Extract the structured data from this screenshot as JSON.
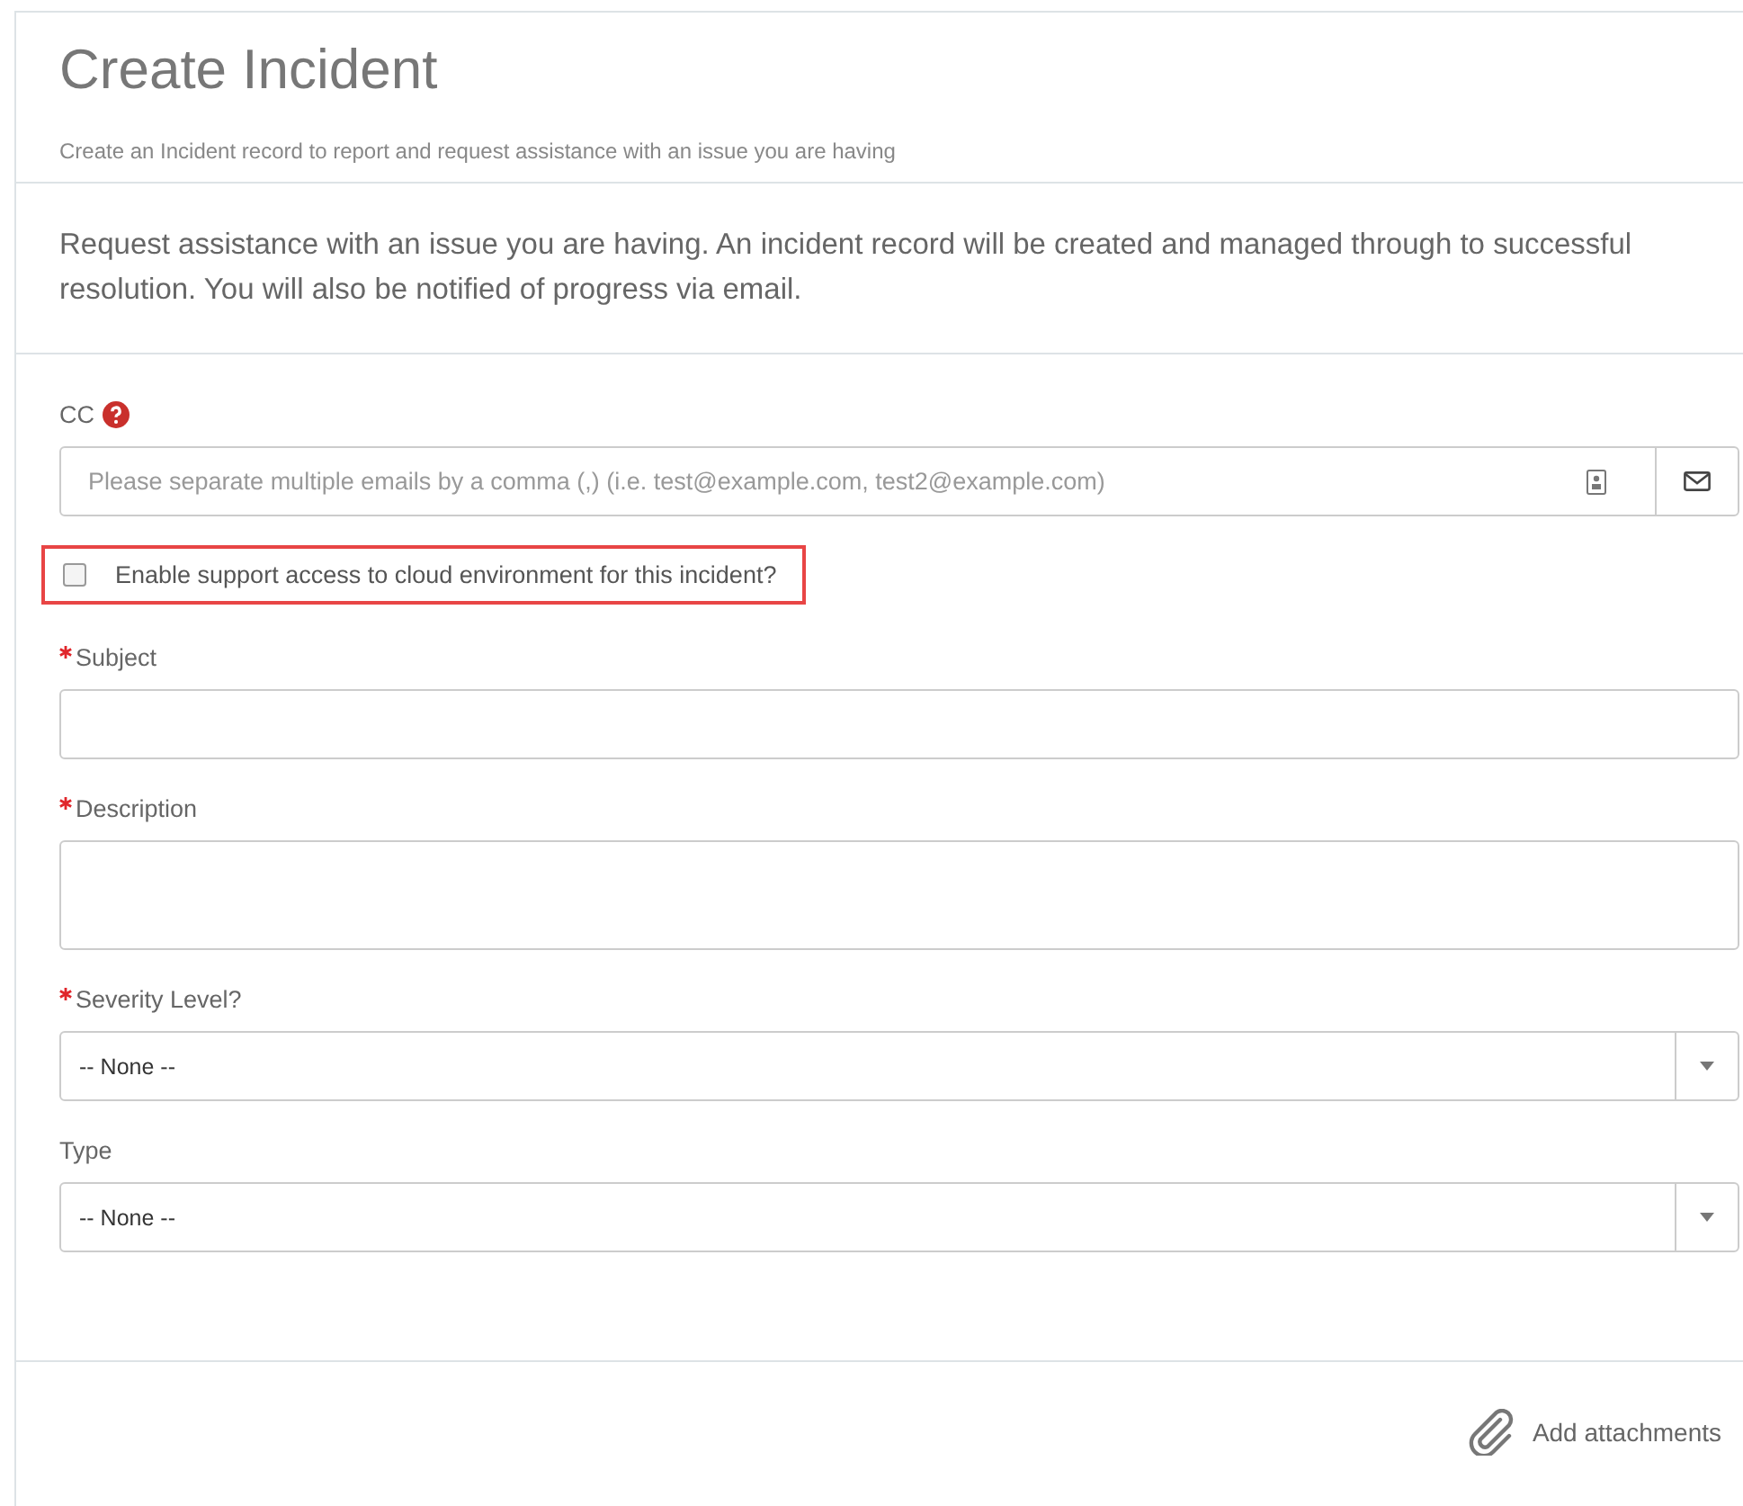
{
  "header": {
    "title": "Create Incident",
    "subtitle": "Create an Incident record to report and request assistance with an issue you are having"
  },
  "intro": "Request assistance with an issue you are having. An incident record will be created and managed through to successful resolution. You will also be notified of progress via email.",
  "fields": [
    {
      "kind": "email",
      "label": "CC",
      "help": true,
      "required": false,
      "placeholder": "Please separate multiple emails by a comma (,) (i.e. test@example.com, test2@example.com)"
    },
    {
      "kind": "checkbox",
      "label": "Enable support access to cloud environment for this incident?",
      "checked": false,
      "highlighted": true
    },
    {
      "kind": "text",
      "label": "Subject",
      "required": true
    },
    {
      "kind": "textarea",
      "label": "Description",
      "required": true
    },
    {
      "kind": "select",
      "label": "Severity Level?",
      "required": true,
      "value": "-- None --"
    },
    {
      "kind": "select",
      "label": "Type",
      "required": false,
      "value": "-- None --"
    }
  ],
  "footer": {
    "attach_label": "Add attachments"
  }
}
